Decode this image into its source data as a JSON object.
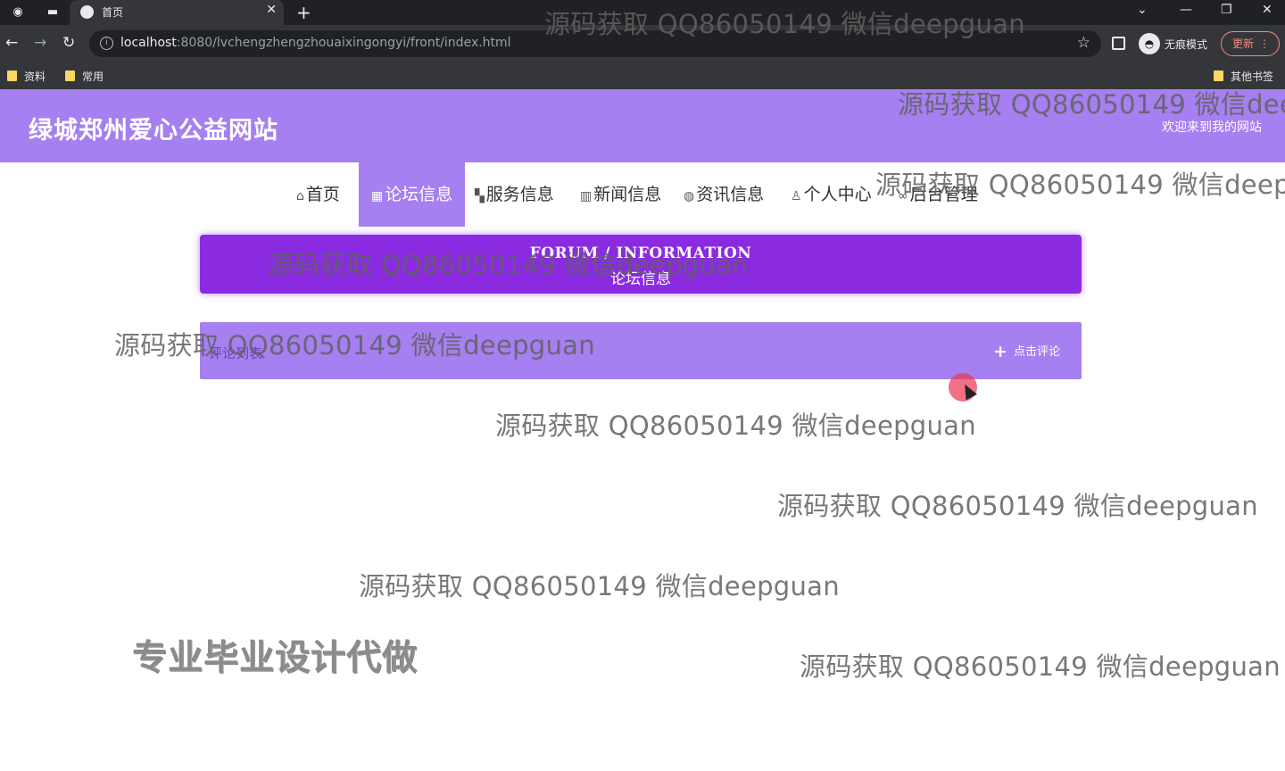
{
  "browser": {
    "tab_title": "首页",
    "url_host": "localhost",
    "url_rest": ":8080/lvchengzhengzhouaixingongyi/front/index.html",
    "incognito_label": "无痕模式",
    "update_label": "更新",
    "bookmarks": [
      {
        "label": "资料"
      },
      {
        "label": "常用"
      },
      {
        "label": "其他书签"
      }
    ]
  },
  "site": {
    "title": "绿城郑州爱心公益网站",
    "welcome": "欢迎来到我的网站",
    "nav": [
      {
        "label": "首页",
        "icon": "home-icon"
      },
      {
        "label": "论坛信息",
        "icon": "forum-icon"
      },
      {
        "label": "服务信息",
        "icon": "service-icon"
      },
      {
        "label": "新闻信息",
        "icon": "news-icon"
      },
      {
        "label": "资讯信息",
        "icon": "info-globe-icon"
      },
      {
        "label": "个人中心",
        "icon": "user-icon"
      },
      {
        "label": "后台管理",
        "icon": "link-icon"
      }
    ],
    "active_nav": "论坛信息"
  },
  "forum": {
    "banner_en": "FORUM / INFORMATION",
    "banner_cn": "论坛信息",
    "list_title": "评论列表",
    "comment_button": "点击评论"
  },
  "overlay": {
    "watermarks": [
      "源码获取 QQ86050149 微信deepguan",
      "源码获取 QQ86050149 微信dee",
      "源码获取 QQ86050149 微信deep",
      "源码获取 QQ86050149 微信deepguan",
      "源码获取 QQ86050149 微信deepguan",
      "源码获取 QQ86050149 微信deepguan",
      "源码获取 QQ86050149 微信deepguan",
      "源码获取 QQ86050149 微信deepguan",
      "源码获取 QQ86050149 微信deepguan"
    ],
    "promo": "专业毕业设计代做"
  },
  "colors": {
    "header": "#a67ff0",
    "banner": "#8a2be2",
    "list_bar": "#a67ff0",
    "chrome_dark": "#202124",
    "chrome_mid": "#35363a"
  }
}
